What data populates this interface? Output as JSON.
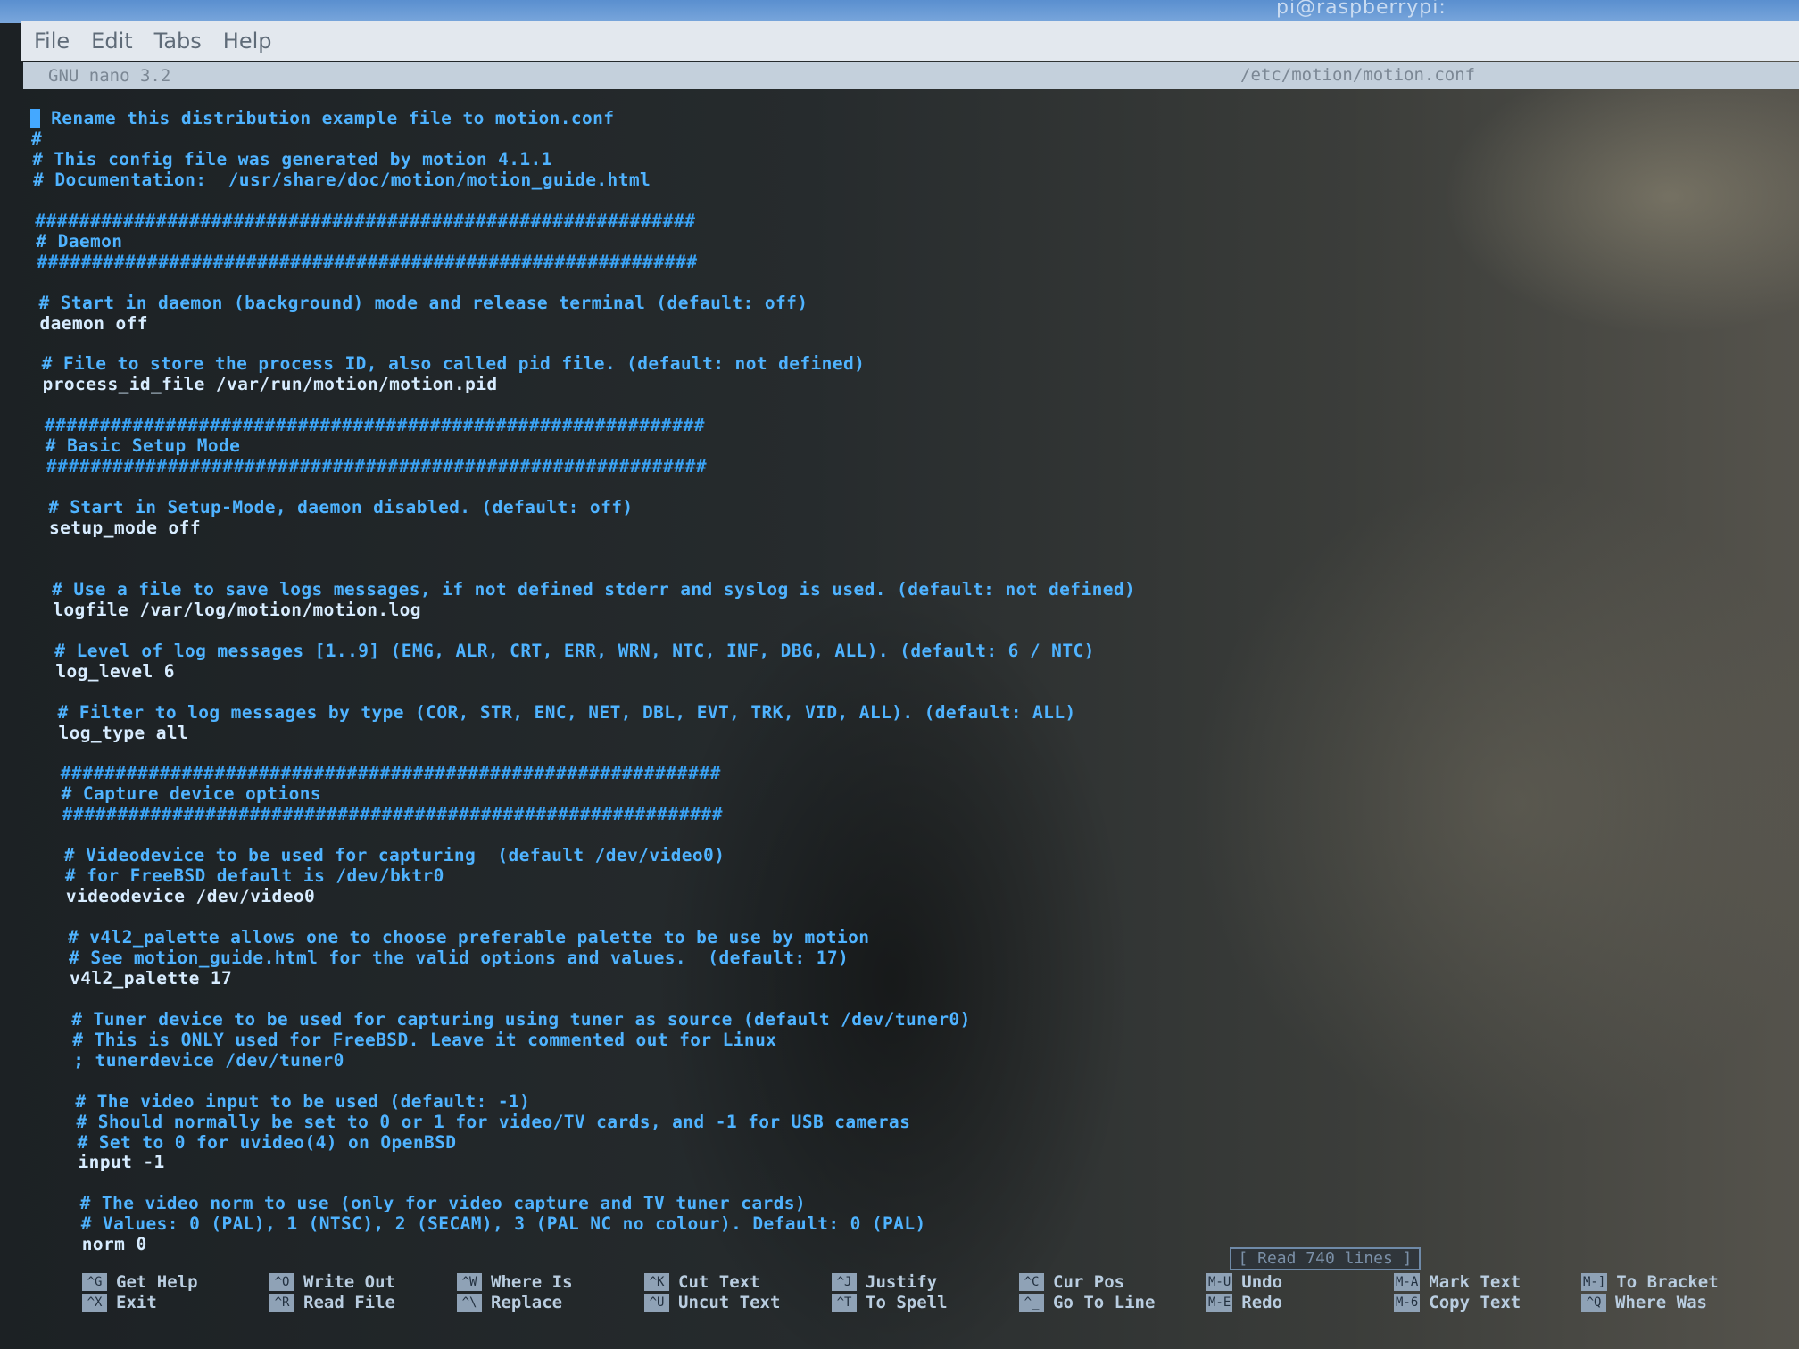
{
  "window": {
    "title": "pi@raspberrypi:"
  },
  "menu": {
    "items": [
      "File",
      "Edit",
      "Tabs",
      "Help"
    ]
  },
  "nano": {
    "version": "GNU nano 3.2",
    "filename": "/etc/motion/motion.conf"
  },
  "lines": [
    {
      "text": "Rename this distribution example file to motion.conf",
      "type": "comment",
      "cursor": true
    },
    {
      "text": "#",
      "type": "comment"
    },
    {
      "text": "# This config file was generated by motion 4.1.1",
      "type": "comment"
    },
    {
      "text": "# Documentation:  /usr/share/doc/motion/motion_guide.html",
      "type": "comment"
    },
    {
      "text": "",
      "type": "blank"
    },
    {
      "text": "############################################################",
      "type": "hash"
    },
    {
      "text": "# Daemon",
      "type": "comment"
    },
    {
      "text": "############################################################",
      "type": "hash"
    },
    {
      "text": "",
      "type": "blank"
    },
    {
      "text": "# Start in daemon (background) mode and release terminal (default: off)",
      "type": "comment"
    },
    {
      "text": "daemon off",
      "type": "cfg"
    },
    {
      "text": "",
      "type": "blank"
    },
    {
      "text": "# File to store the process ID, also called pid file. (default: not defined)",
      "type": "comment"
    },
    {
      "text": "process_id_file /var/run/motion/motion.pid",
      "type": "cfg"
    },
    {
      "text": "",
      "type": "blank"
    },
    {
      "text": "############################################################",
      "type": "hash"
    },
    {
      "text": "# Basic Setup Mode",
      "type": "comment"
    },
    {
      "text": "############################################################",
      "type": "hash"
    },
    {
      "text": "",
      "type": "blank"
    },
    {
      "text": "# Start in Setup-Mode, daemon disabled. (default: off)",
      "type": "comment"
    },
    {
      "text": "setup_mode off",
      "type": "cfg"
    },
    {
      "text": "",
      "type": "blank"
    },
    {
      "text": "",
      "type": "blank"
    },
    {
      "text": "# Use a file to save logs messages, if not defined stderr and syslog is used. (default: not defined)",
      "type": "comment"
    },
    {
      "text": "logfile /var/log/motion/motion.log",
      "type": "cfg"
    },
    {
      "text": "",
      "type": "blank"
    },
    {
      "text": "# Level of log messages [1..9] (EMG, ALR, CRT, ERR, WRN, NTC, INF, DBG, ALL). (default: 6 / NTC)",
      "type": "comment"
    },
    {
      "text": "log_level 6",
      "type": "cfg"
    },
    {
      "text": "",
      "type": "blank"
    },
    {
      "text": "# Filter to log messages by type (COR, STR, ENC, NET, DBL, EVT, TRK, VID, ALL). (default: ALL)",
      "type": "comment"
    },
    {
      "text": "log_type all",
      "type": "cfg"
    },
    {
      "text": "",
      "type": "blank"
    },
    {
      "text": "############################################################",
      "type": "hash"
    },
    {
      "text": "# Capture device options",
      "type": "comment"
    },
    {
      "text": "############################################################",
      "type": "hash"
    },
    {
      "text": "",
      "type": "blank"
    },
    {
      "text": "# Videodevice to be used for capturing  (default /dev/video0)",
      "type": "comment"
    },
    {
      "text": "# for FreeBSD default is /dev/bktr0",
      "type": "comment"
    },
    {
      "text": "videodevice /dev/video0",
      "type": "cfg"
    },
    {
      "text": "",
      "type": "blank"
    },
    {
      "text": "# v4l2_palette allows one to choose preferable palette to be use by motion",
      "type": "comment"
    },
    {
      "text": "# See motion_guide.html for the valid options and values.  (default: 17)",
      "type": "comment"
    },
    {
      "text": "v4l2_palette 17",
      "type": "cfg"
    },
    {
      "text": "",
      "type": "blank"
    },
    {
      "text": "# Tuner device to be used for capturing using tuner as source (default /dev/tuner0)",
      "type": "comment"
    },
    {
      "text": "# This is ONLY used for FreeBSD. Leave it commented out for Linux",
      "type": "comment"
    },
    {
      "text": "; tunerdevice /dev/tuner0",
      "type": "comment"
    },
    {
      "text": "",
      "type": "blank"
    },
    {
      "text": "# The video input to be used (default: -1)",
      "type": "comment"
    },
    {
      "text": "# Should normally be set to 0 or 1 for video/TV cards, and -1 for USB cameras",
      "type": "comment"
    },
    {
      "text": "# Set to 0 for uvideo(4) on OpenBSD",
      "type": "comment"
    },
    {
      "text": "input -1",
      "type": "cfg"
    },
    {
      "text": "",
      "type": "blank"
    },
    {
      "text": "# The video norm to use (only for video capture and TV tuner cards)",
      "type": "comment"
    },
    {
      "text": "# Values: 0 (PAL), 1 (NTSC), 2 (SECAM), 3 (PAL NC no colour). Default: 0 (PAL)",
      "type": "comment"
    },
    {
      "text": "norm 0",
      "type": "cfg"
    }
  ],
  "status": {
    "message": "[ Read 740 lines ]"
  },
  "shortcuts": [
    {
      "key": "^G",
      "label": "Get Help"
    },
    {
      "key": "^X",
      "label": "Exit"
    },
    {
      "key": "^O",
      "label": "Write Out"
    },
    {
      "key": "^R",
      "label": "Read File"
    },
    {
      "key": "^W",
      "label": "Where Is"
    },
    {
      "key": "^\\",
      "label": "Replace"
    },
    {
      "key": "^K",
      "label": "Cut Text"
    },
    {
      "key": "^U",
      "label": "Uncut Text"
    },
    {
      "key": "^J",
      "label": "Justify"
    },
    {
      "key": "^T",
      "label": "To Spell"
    },
    {
      "key": "^C",
      "label": "Cur Pos"
    },
    {
      "key": "^_",
      "label": "Go To Line"
    },
    {
      "key": "M-U",
      "label": "Undo"
    },
    {
      "key": "M-E",
      "label": "Redo"
    },
    {
      "key": "M-A",
      "label": "Mark Text"
    },
    {
      "key": "M-6",
      "label": "Copy Text"
    },
    {
      "key": "M-]",
      "label": "To Bracket"
    },
    {
      "key": "^Q",
      "label": "Where Was"
    }
  ],
  "colors": {
    "comment": "#4fb3ff",
    "config": "#d7ecff",
    "menubar": "#e3e8ee",
    "shortcut_key": "#8fa2b6"
  }
}
